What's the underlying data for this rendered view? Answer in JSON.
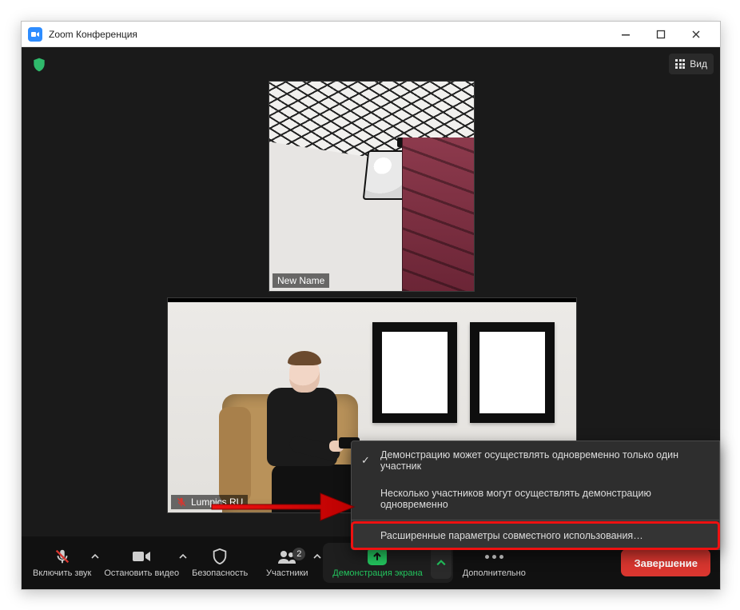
{
  "window": {
    "title": "Zoom Конференция"
  },
  "top": {
    "view_label": "Вид"
  },
  "tiles": {
    "tile1_name": "New Name",
    "tile2_name": "Lumpics RU"
  },
  "context_menu": {
    "opt_one_at_time": "Демонстрацию может осуществлять одновременно только один участник",
    "opt_multiple": "Несколько участников могут осуществлять демонстрацию одновременно",
    "opt_advanced": "Расширенные параметры совместного использования…"
  },
  "toolbar": {
    "audio": "Включить звук",
    "video": "Остановить видео",
    "security": "Безопасность",
    "participants": "Участники",
    "participants_count": "2",
    "share": "Демонстрация экрана",
    "more": "Дополнительно",
    "end": "Завершение"
  }
}
